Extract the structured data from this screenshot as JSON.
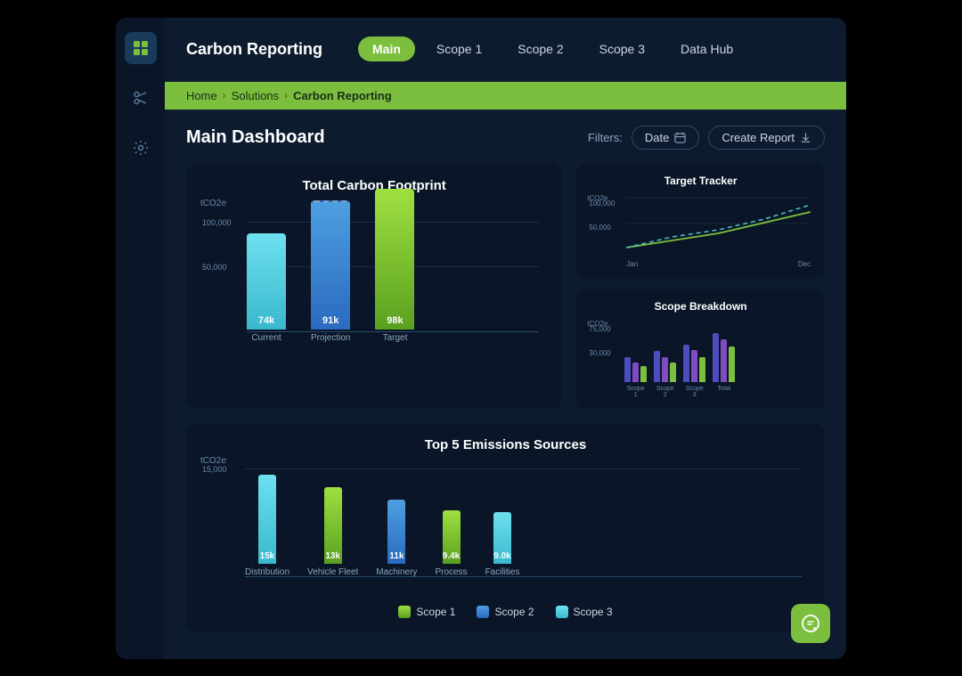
{
  "app": {
    "title": "Carbon Reporting",
    "window_bg": "#0d1b2e"
  },
  "header": {
    "title": "Carbon Reporting",
    "nav": {
      "tabs": [
        {
          "label": "Main",
          "active": true
        },
        {
          "label": "Scope 1",
          "active": false
        },
        {
          "label": "Scope 2",
          "active": false
        },
        {
          "label": "Scope 3",
          "active": false
        },
        {
          "label": "Data Hub",
          "active": false
        }
      ]
    }
  },
  "sidebar": {
    "icons": [
      {
        "name": "grid-icon",
        "symbol": "⊞",
        "active": true
      },
      {
        "name": "scissors-icon",
        "symbol": "✂",
        "active": false
      },
      {
        "name": "settings-icon",
        "symbol": "⚙",
        "active": false
      }
    ]
  },
  "breadcrumb": {
    "items": [
      "Home",
      "Solutions",
      "Carbon Reporting"
    ]
  },
  "dashboard": {
    "title": "Main Dashboard",
    "filters_label": "Filters:",
    "date_filter": "Date",
    "create_report": "Create Report",
    "total_carbon": {
      "title": "Total Carbon Footprint",
      "y_label": "tCO2e",
      "y_ticks": [
        "100,000",
        "50,000"
      ],
      "bars": [
        {
          "label": "Current",
          "value": "74k",
          "height_pct": 60,
          "color": "#4dbfce"
        },
        {
          "label": "Projection",
          "value": "91k",
          "height_pct": 82,
          "color": "#4d8fcf",
          "dashed": true
        },
        {
          "label": "Target",
          "value": "98k",
          "height_pct": 88,
          "color": "#7cbf3e"
        }
      ]
    },
    "target_tracker": {
      "title": "Target Tracker",
      "y_label": "tCO2e",
      "y_100k": "100,000",
      "y_50k": "50,000",
      "x_jan": "Jan",
      "x_dec": "Dec"
    },
    "scope_breakdown": {
      "title": "Scope Breakdown",
      "y_label": "tCO2e",
      "y_75k": "75,000",
      "y_30k": "30,000",
      "x_labels": [
        "Scope 1",
        "Scope 2",
        "Scope 3",
        "Total"
      ],
      "colors": [
        "#4d4dbf",
        "#7f4dbf",
        "#7cbf3e",
        "#4dbfce"
      ]
    },
    "top5": {
      "title": "Top 5 Emissions Sources",
      "y_label": "tCO2e",
      "y_15k": "15,000",
      "bars": [
        {
          "label": "Distribution",
          "value": "15k",
          "heights": [
            90,
            0
          ],
          "colors": [
            "#4dbfce",
            null
          ]
        },
        {
          "label": "Vehicle Fleet",
          "value": "13k",
          "heights": [
            0,
            80
          ],
          "colors": [
            null,
            "#7cbf3e"
          ]
        },
        {
          "label": "Machinery",
          "value": "11k",
          "heights": [
            65,
            0
          ],
          "colors": [
            "#4d8fcf",
            null
          ]
        },
        {
          "label": "Process",
          "value": "9.4k",
          "heights": [
            0,
            55
          ],
          "colors": [
            null,
            "#7cbf3e"
          ]
        },
        {
          "label": "Facilities",
          "value": "9.0k",
          "heights": [
            55,
            0
          ],
          "colors": [
            "#4dbfce",
            null
          ]
        }
      ]
    },
    "legend": [
      {
        "label": "Scope 1",
        "color": "#7cbf3e"
      },
      {
        "label": "Scope 2",
        "color": "#4d8fcf"
      },
      {
        "label": "Scope 3",
        "color": "#4dbfce"
      }
    ]
  },
  "chat_button": {
    "icon": "🔔"
  }
}
